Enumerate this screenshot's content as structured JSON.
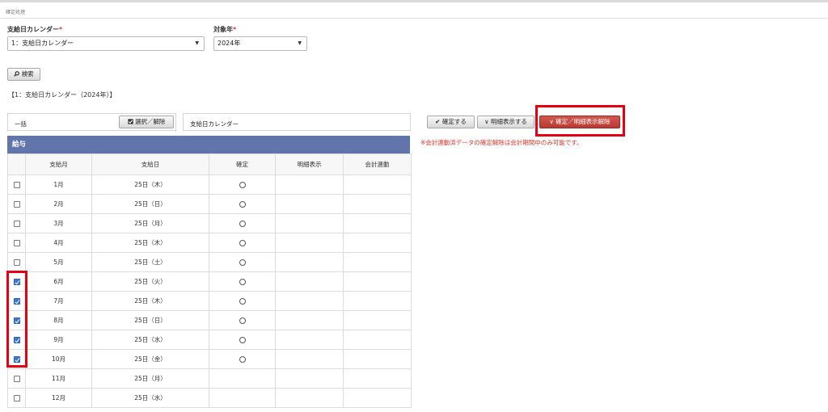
{
  "page": {
    "title": "確定処理"
  },
  "filters": {
    "calendar": {
      "label": "支給日カレンダー",
      "required_mark": "*",
      "value": "1：支給日カレンダー"
    },
    "year": {
      "label": "対象年",
      "required_mark": "*",
      "value": "2024年"
    }
  },
  "search_button": {
    "icon": "search-icon",
    "label": "検索"
  },
  "calendar_heading": "【1：支給日カレンダー（2024年）】",
  "bulk_bar": {
    "label": "一括",
    "toggle_button": {
      "icon": "checkbox-icon",
      "label": "選択／解除"
    },
    "calendar_label": "支給日カレンダー",
    "confirm_button": {
      "icon": "checkmark-icon",
      "label": "✔ 確定する"
    },
    "show_detail_button": {
      "icon": "chevron-down-icon",
      "label": "∨ 明細表示する"
    },
    "unconfirm_button": {
      "icon": "chevron-down-icon",
      "label": "∨ 確定／明細表示解除"
    }
  },
  "note": "※会計連動済データの確定解除は会計期間中のみ可能です。",
  "section": {
    "title": "給与"
  },
  "table": {
    "headers": [
      "",
      "支給月",
      "支給日",
      "確定",
      "明細表示",
      "会計連動"
    ],
    "rows": [
      {
        "checked": false,
        "month": "1月",
        "date": "25日（木）",
        "confirmed": true
      },
      {
        "checked": false,
        "month": "2月",
        "date": "25日（日）",
        "confirmed": true
      },
      {
        "checked": false,
        "month": "3月",
        "date": "25日（月）",
        "confirmed": true
      },
      {
        "checked": false,
        "month": "4月",
        "date": "25日（木）",
        "confirmed": true
      },
      {
        "checked": false,
        "month": "5月",
        "date": "25日（土）",
        "confirmed": true
      },
      {
        "checked": true,
        "month": "6月",
        "date": "25日（火）",
        "confirmed": true
      },
      {
        "checked": true,
        "month": "7月",
        "date": "25日（木）",
        "confirmed": true
      },
      {
        "checked": true,
        "month": "8月",
        "date": "25日（日）",
        "confirmed": true
      },
      {
        "checked": true,
        "month": "9月",
        "date": "25日（水）",
        "confirmed": true
      },
      {
        "checked": true,
        "month": "10月",
        "date": "25日（金）",
        "confirmed": true
      },
      {
        "checked": false,
        "month": "11月",
        "date": "25日（月）",
        "confirmed": false
      },
      {
        "checked": false,
        "month": "12月",
        "date": "25日（水）",
        "confirmed": false
      }
    ]
  },
  "colors": {
    "section_header": "#6275aa",
    "highlight": "#e60012",
    "danger_button": "#c0443a",
    "note_text": "#d9342b",
    "checkbox_checked": "#3b76e1"
  }
}
